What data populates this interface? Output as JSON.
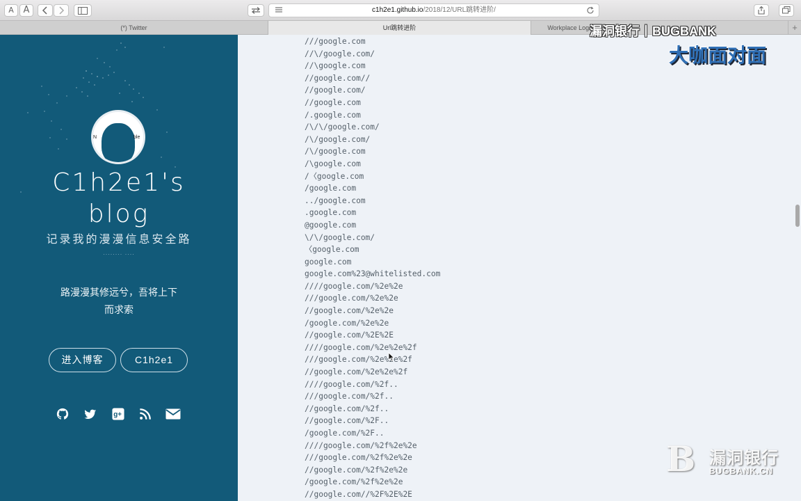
{
  "toolbar": {
    "font_small_label": "A",
    "font_large_label": "A",
    "url_domain": "c1h2e1.github.io",
    "url_path": "/2018/12/URL跳转进阶/"
  },
  "tabs": [
    {
      "label": "(*) Twitter"
    },
    {
      "label": "Url跳转进阶"
    },
    {
      "label": "Workplace Logo..."
    }
  ],
  "sidebar": {
    "avatar_text_left": "N",
    "avatar_text_right": "ble",
    "title_line1": "C1h2e1's",
    "title_line2": "blog",
    "subtitle": "记录我的漫漫信息安全路",
    "dots": "........    ....",
    "quote_line1": "路漫漫其修远兮，吾将上下",
    "quote_line2": "而求索",
    "btn_enter": "进入博客",
    "btn_name": "C1h2e1",
    "social_icons": [
      "github-icon",
      "twitter-icon",
      "google-plus-icon",
      "rss-icon",
      "mail-icon"
    ]
  },
  "code_lines": [
    "///google.com",
    "//\\/google.com/",
    "//\\google.com",
    "//google.com//",
    "//google.com/",
    "//google.com",
    "/.google.com",
    "/\\/\\/google.com/",
    "/\\/google.com/",
    "/\\/google.com",
    "/\\google.com",
    "/〈google.com",
    "/google.com",
    "../google.com",
    ".google.com",
    "@google.com",
    "\\/\\/google.com/",
    "〈google.com",
    "google.com",
    "google.com%23@whitelisted.com",
    "////google.com/%2e%2e",
    "///google.com/%2e%2e",
    "//google.com/%2e%2e",
    "/google.com/%2e%2e",
    "//google.com/%2E%2E",
    "////google.com/%2e%2e%2f",
    "///google.com/%2e%2e%2f",
    "//google.com/%2e%2e%2f",
    "////google.com/%2f..",
    "///google.com/%2f..",
    "//google.com/%2f..",
    "//google.com/%2F..",
    "/google.com/%2F..",
    "////google.com/%2f%2e%2e",
    "///google.com/%2f%2e%2e",
    "//google.com/%2f%2e%2e",
    "/google.com/%2f%2e%2e",
    "//google.com//%2F%2E%2E"
  ],
  "watermark": {
    "top_line": "漏洞银行丨BUGBANK",
    "top_big": "大咖面对面",
    "logo_mark": "B",
    "logo_cn": "漏洞银行",
    "logo_en": "BUGBANK.CN"
  },
  "colors": {
    "sidebar_bg": "#125a79",
    "main_bg": "#eef2f7",
    "code_text": "#55606a"
  }
}
